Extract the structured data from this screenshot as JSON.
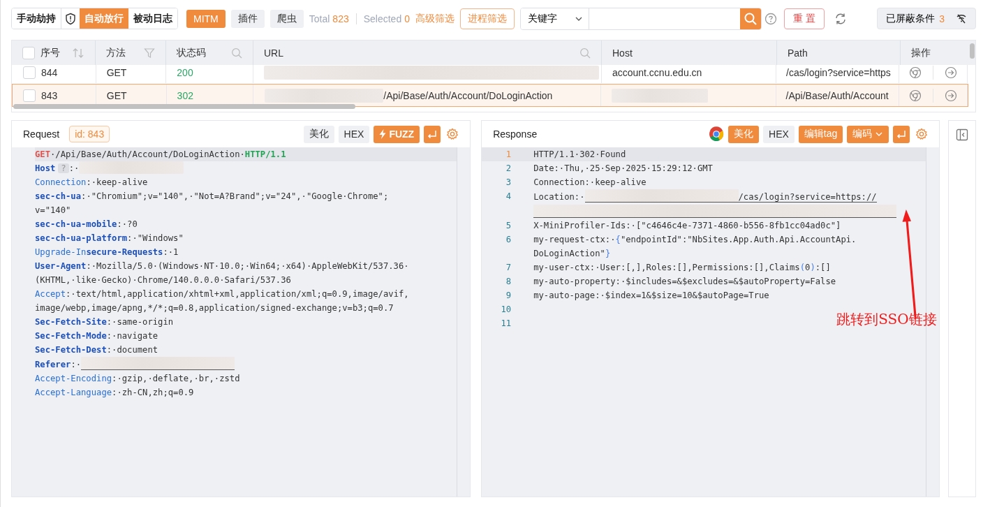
{
  "toolbar": {
    "modes": [
      {
        "label": "手动劫持",
        "selected": false
      },
      {
        "label": "自动放行",
        "selected": true
      },
      {
        "label": "被动日志",
        "selected": false
      }
    ],
    "tools": [
      {
        "label": "MITM",
        "selected": true
      },
      {
        "label": "插件",
        "selected": false
      },
      {
        "label": "爬虫",
        "selected": false
      }
    ],
    "total_label": "Total",
    "total": "823",
    "selected_label": "Selected",
    "selected_count": "0",
    "advanced_filter": "高级筛选",
    "process_filter": "进程筛选",
    "search_scope": "关键字",
    "reset": "重 置",
    "blocked_label": "已屏蔽条件",
    "blocked_count": "3"
  },
  "table": {
    "header_checked": false,
    "columns": [
      "序号",
      "方法",
      "状态码",
      "URL",
      "Host",
      "Path",
      "操作"
    ],
    "rows": [
      {
        "seq": "844",
        "method": "GET",
        "status": "200",
        "host": "account.ccnu.edu.cn",
        "path": "/cas/login?service=https",
        "selected": false,
        "checked": false
      },
      {
        "seq": "843",
        "method": "GET",
        "status": "302",
        "url_suffix": "/Api/Base/Auth/Account/DoLoginAction",
        "path": "/Api/Base/Auth/Account",
        "selected": true,
        "checked": false
      }
    ]
  },
  "request": {
    "title": "Request",
    "id_label": "id: 843",
    "beautify": {
      "label": "美化",
      "selected": false
    },
    "hex": {
      "label": "HEX",
      "selected": false
    },
    "fuzz": "FUZZ",
    "lines": [
      [
        {
          "kind": "method",
          "text": "GET"
        },
        {
          "kind": "value",
          "text": "·/Api/Base/Auth/Account/DoLoginAction·"
        },
        {
          "kind": "version",
          "text": "HTTP/1.1"
        }
      ],
      [
        {
          "kind": "keybold",
          "text": "Host"
        },
        {
          "kind": "badge",
          "text": "?"
        },
        {
          "kind": "value",
          "text": ":·"
        },
        {
          "kind": "redacted"
        }
      ],
      [
        {
          "kind": "key",
          "text": "Connection"
        },
        {
          "kind": "value",
          "text": ":·keep-alive"
        }
      ],
      [
        {
          "kind": "keybold",
          "text": "sec-ch-ua"
        },
        {
          "kind": "value",
          "text": ":·\"Chromium\";v=\"140\",·\"Not=A?Brand\";v=\"24\",·\"Google·Chrome\";"
        },
        {
          "kind": "cont",
          "text": "v=\"140\""
        }
      ],
      [
        {
          "kind": "keybold",
          "text": "sec-ch-ua-mobile"
        },
        {
          "kind": "value",
          "text": ":·?0"
        }
      ],
      [
        {
          "kind": "keybold",
          "text": "sec-ch-ua-platform"
        },
        {
          "kind": "value",
          "text": ":·\"Windows\""
        }
      ],
      [
        {
          "kind": "key",
          "text": "Upgrade-In"
        },
        {
          "kind": "keybold",
          "text": "secure-Requests"
        },
        {
          "kind": "value",
          "text": ":·1"
        }
      ],
      [
        {
          "kind": "keybold",
          "text": "User-Agent"
        },
        {
          "kind": "value",
          "text": ":·Mozilla/5.0·(Windows·NT·10.0;·Win64;·x64)·AppleWebKit/537.36·"
        },
        {
          "kind": "cont",
          "text": "(KHTML,·like·Gecko)·Chrome/140.0.0.0·Safari/537.36"
        }
      ],
      [
        {
          "kind": "key",
          "text": "Accept"
        },
        {
          "kind": "value",
          "text": ":·text/html,application/xhtml+xml,application/xml;q=0.9,image/avif,"
        },
        {
          "kind": "cont",
          "text": "image/webp,image/apng,*/*;q=0.8,application/signed-exchange;v=b3;q=0.7"
        }
      ],
      [
        {
          "kind": "keybold",
          "text": "Sec-Fetch-Site"
        },
        {
          "kind": "value",
          "text": ":·same-origin"
        }
      ],
      [
        {
          "kind": "keybold",
          "text": "Sec-Fetch-Mode"
        },
        {
          "kind": "value",
          "text": ":·navigate"
        }
      ],
      [
        {
          "kind": "keybold",
          "text": "Sec-Fetch-Dest"
        },
        {
          "kind": "value",
          "text": ":·document"
        }
      ],
      [
        {
          "kind": "keybold",
          "text": "Referer"
        },
        {
          "kind": "value",
          "text": ":·"
        },
        {
          "kind": "redacted-link"
        }
      ],
      [
        {
          "kind": "key",
          "text": "Accept-Encoding"
        },
        {
          "kind": "value",
          "text": ":·gzip,·deflate,·br,·zstd"
        }
      ],
      [
        {
          "kind": "key",
          "text": "Accept-Language"
        },
        {
          "kind": "value",
          "text": ":·zh-CN,zh;q=0.9"
        }
      ]
    ]
  },
  "response": {
    "title": "Response",
    "beautify": {
      "label": "美化",
      "selected": true
    },
    "hex": {
      "label": "HEX",
      "selected": false
    },
    "edit_tag": "编辑tag",
    "encoding": "编码",
    "lines": [
      {
        "num": "1",
        "active": true,
        "tokens": [
          {
            "kind": "text",
            "text": "HTTP/1.1·302·Found"
          }
        ]
      },
      {
        "num": "2",
        "active": false,
        "tokens": [
          {
            "kind": "text",
            "text": "Date:·Thu,·25·Sep·2025·15:29:12·GMT"
          }
        ]
      },
      {
        "num": "3",
        "active": false,
        "tokens": [
          {
            "kind": "text",
            "text": "Connection:·keep-alive"
          }
        ]
      },
      {
        "num": "4",
        "active": false,
        "tokens": [
          {
            "kind": "text",
            "text": "Location:·"
          },
          {
            "kind": "redacted-link"
          },
          {
            "kind": "link",
            "text": "/cas/login?service=https://"
          },
          {
            "kind": "redacted-line"
          }
        ]
      },
      {
        "num": "5",
        "active": false,
        "tokens": [
          {
            "kind": "text",
            "text": "X-MiniProfiler-Ids:·[\"c4646c4e-7371-4860-b556-8fb1cc04ad0c\"]"
          }
        ]
      },
      {
        "num": "6",
        "active": false,
        "tokens": [
          {
            "kind": "text",
            "text": "my-request-ctx:·"
          },
          {
            "kind": "bracket",
            "text": "{"
          },
          {
            "kind": "text",
            "text": "\"endpointId\":\"NbSites.App.Auth.Api.AccountApi."
          },
          {
            "kind": "cont",
            "text": "DoLoginAction\""
          },
          {
            "kind": "bracket",
            "text": "}"
          }
        ]
      },
      {
        "num": "7",
        "active": false,
        "tokens": [
          {
            "kind": "text",
            "text": "my-user-ctx:·User:[,],Roles:[],Permissions:[],Claims"
          },
          {
            "kind": "bracket",
            "text": "("
          },
          {
            "kind": "text",
            "text": "0"
          },
          {
            "kind": "bracket",
            "text": ")"
          },
          {
            "kind": "text",
            "text": ":[]"
          }
        ]
      },
      {
        "num": "8",
        "active": false,
        "tokens": [
          {
            "kind": "text",
            "text": "my-auto-property:·$includes=&$excludes=&$autoProperty=False"
          }
        ]
      },
      {
        "num": "9",
        "active": false,
        "tokens": [
          {
            "kind": "text",
            "text": "my-auto-page:·$index=1&$size=10&$autoPage=True"
          }
        ]
      },
      {
        "num": "10",
        "active": false
      },
      {
        "num": "11",
        "active": false
      }
    ],
    "annotation": "跳转到SSO链接"
  }
}
